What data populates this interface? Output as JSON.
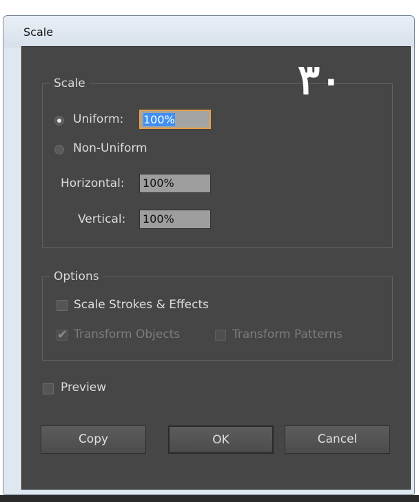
{
  "window": {
    "title": "Scale"
  },
  "watermark": "۳۰",
  "scale_group": {
    "legend": "Scale",
    "uniform": {
      "label": "Uniform:",
      "value_selected": "100%",
      "checked": true
    },
    "non_uniform": {
      "label": "Non-Uniform",
      "checked": false
    },
    "horizontal": {
      "label": "Horizontal:",
      "value": "100%"
    },
    "vertical": {
      "label": "Vertical:",
      "value": "100%"
    }
  },
  "options_group": {
    "legend": "Options",
    "scale_strokes": {
      "label": "Scale Strokes & Effects",
      "checked": false
    },
    "transform_objects": {
      "label": "Transform Objects",
      "checked": true,
      "enabled": false
    },
    "transform_patterns": {
      "label": "Transform Patterns",
      "checked": false,
      "enabled": false
    }
  },
  "preview": {
    "label": "Preview",
    "checked": false
  },
  "buttons": {
    "copy": "Copy",
    "ok": "OK",
    "cancel": "Cancel"
  },
  "colors": {
    "dialog_bg": "#464646",
    "focus_ring": "#e9a043",
    "selection": "#3f8ff4"
  }
}
